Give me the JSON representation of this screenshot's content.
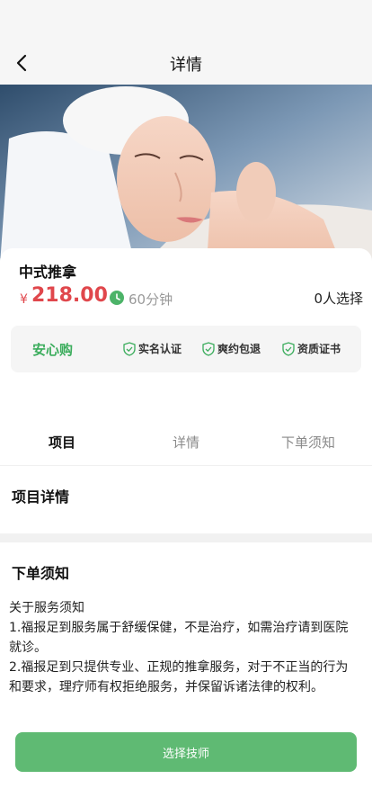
{
  "header": {
    "title": "详情",
    "back_icon": "chevron-left-icon"
  },
  "hero": {
    "description": "massage-photo"
  },
  "service": {
    "name": "中式推拿",
    "currency": "¥",
    "price": "218.00",
    "duration": "60分钟",
    "selected_count": "0人选择",
    "price_color": "#e0474c"
  },
  "assurance": {
    "title": "安心购",
    "items": [
      "实名认证",
      "爽约包退",
      "资质证书"
    ],
    "accent": "#3cad5d"
  },
  "tabs": [
    {
      "label": "项目",
      "active": true
    },
    {
      "label": "详情",
      "active": false
    },
    {
      "label": "下单须知",
      "active": false
    }
  ],
  "sections": {
    "project_title": "项目详情",
    "notice_title": "下单须知"
  },
  "notice": {
    "lines": [
      "关于服务须知",
      "1.福报足到服务属于舒缓保健，不是治疗，如需治疗请到医院",
      "就诊。",
      "2.福报足到只提供专业、正规的推拿服务，对于不正当的行为 和要求，理疗师有权拒绝服务，并保留诉诸法律的权利。"
    ]
  },
  "footer": {
    "button_label": "选择技师",
    "button_color": "#5fba73"
  }
}
